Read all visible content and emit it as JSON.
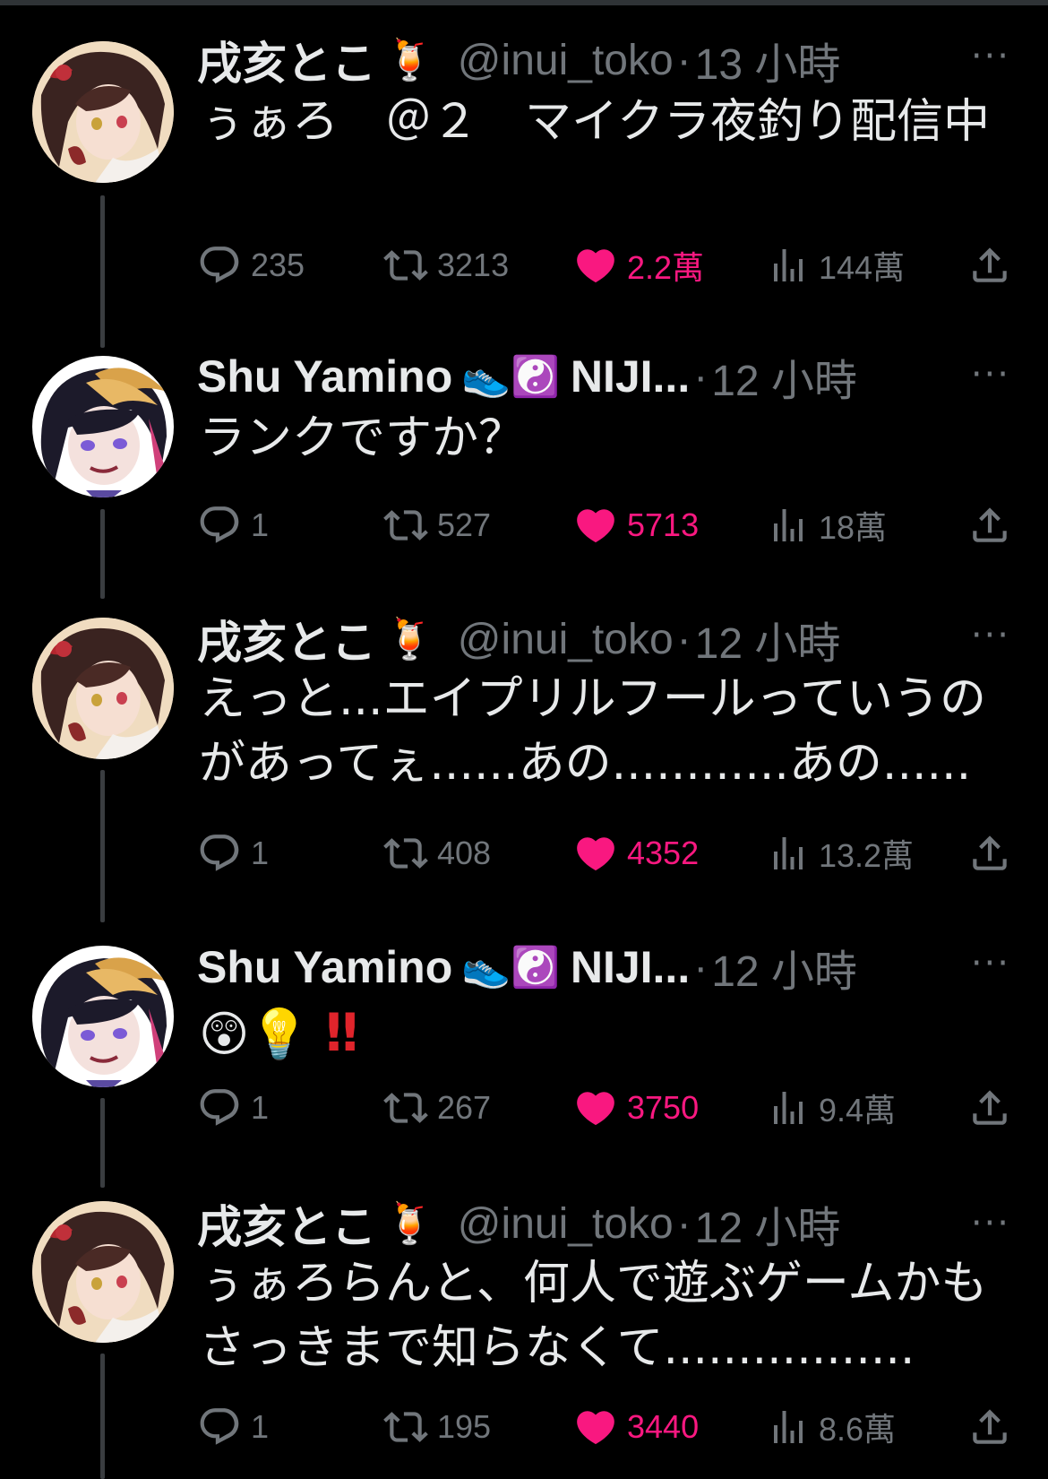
{
  "tweets": [
    {
      "display_name": "戌亥とこ",
      "name_emoji": "🍹",
      "handle": "@inui_toko",
      "dot": "·",
      "time": "13 小時",
      "text": "ぅぁろ　＠２　マイクラ夜釣り配信中",
      "replies": "235",
      "retweets": "3213",
      "likes": "2.2萬",
      "views": "144萬",
      "avatar": "toko"
    },
    {
      "display_name": "Shu Yamino",
      "name_emoji": "👟☯️",
      "name_suffix": "NIJI...",
      "dot": "·",
      "time": "12 小時",
      "text": "ランクですか？",
      "replies": "1",
      "retweets": "527",
      "likes": "5713",
      "views": "18萬",
      "avatar": "shu"
    },
    {
      "display_name": "戌亥とこ",
      "name_emoji": "🍹",
      "handle": "@inui_toko",
      "dot": "·",
      "time": "12 小時",
      "text": "えっと...エイプリルフールっていうのがあってぇ......あの............あの......",
      "replies": "1",
      "retweets": "408",
      "likes": "4352",
      "views": "13.2萬",
      "avatar": "toko"
    },
    {
      "display_name": "Shu Yamino",
      "name_emoji": "👟☯️",
      "name_suffix": "NIJI...",
      "dot": "·",
      "time": "12 小時",
      "text_emoji": "😲💡",
      "text_bang": "‼",
      "replies": "1",
      "retweets": "267",
      "likes": "3750",
      "views": "9.4萬",
      "avatar": "shu"
    },
    {
      "display_name": "戌亥とこ",
      "name_emoji": "🍹",
      "handle": "@inui_toko",
      "dot": "·",
      "time": "12 小時",
      "text": "ぅぁろらんと、何人で遊ぶゲームかもさっきまで知らなくて.................",
      "replies": "1",
      "retweets": "195",
      "likes": "3440",
      "views": "8.6萬",
      "avatar": "toko"
    }
  ],
  "more_label": "···",
  "colors": {
    "background": "#000000",
    "text": "#e7e9ea",
    "secondary": "#71767b",
    "like": "#f91880",
    "thread_line": "#3a3d40"
  },
  "icons": [
    "reply-icon",
    "retweet-icon",
    "like-icon",
    "views-icon",
    "share-icon",
    "more-icon"
  ]
}
